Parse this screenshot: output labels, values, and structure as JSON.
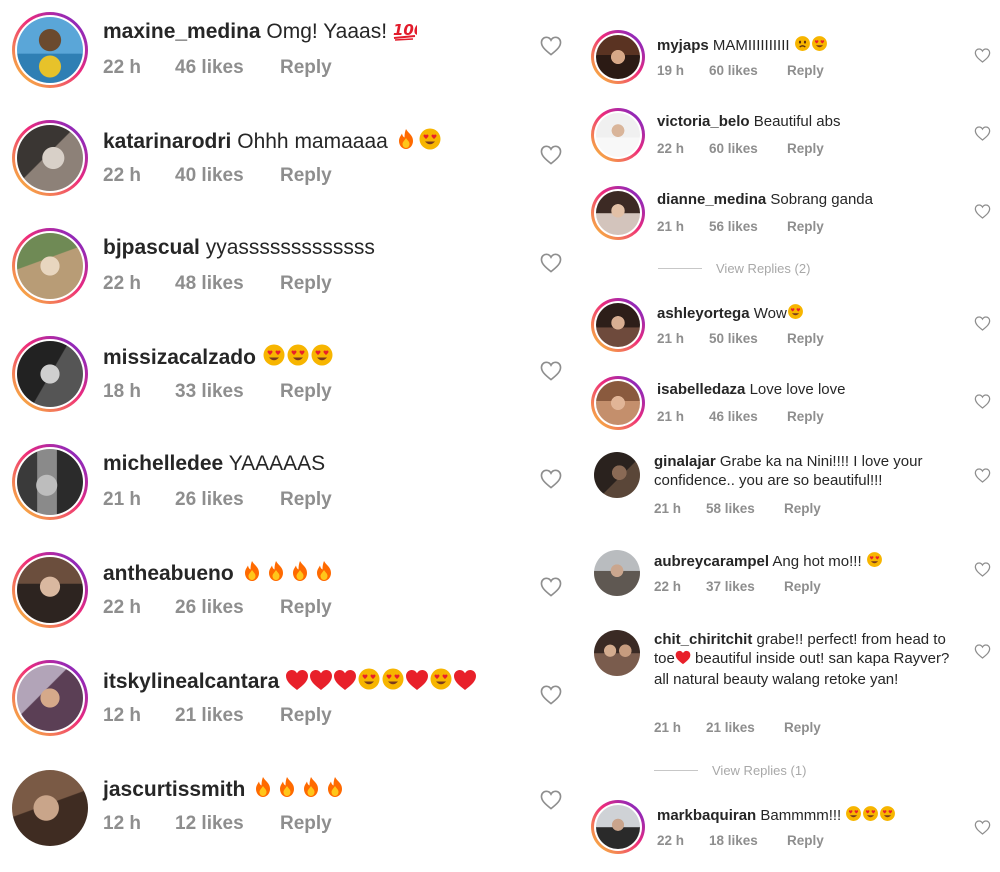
{
  "colors": {
    "story_ring": "#ee2a7b",
    "meta_text": "#8e8e8e",
    "reply_text": "#a8a8a8",
    "emoji_face": "#f7b500",
    "emoji_heart": "#e8202a",
    "emoji_fire": "#ff6a00",
    "emoji_100": "#e21c2c"
  },
  "left_comments": [
    {
      "user": "maxine_medina",
      "text": "Omg! Yaaas!",
      "emoji": [
        "100-emoji"
      ],
      "time": "22 h",
      "likes": "46 likes",
      "reply": "Reply"
    },
    {
      "user": "katarinarodri",
      "text": "Ohhh mamaaaa",
      "emoji": [
        "fire-emoji",
        "heart-eyes-emoji"
      ],
      "time": "22 h",
      "likes": "40 likes",
      "reply": "Reply"
    },
    {
      "user": "bjpascual",
      "text": "yyasssssssssssss",
      "emoji": [],
      "time": "22 h",
      "likes": "48 likes",
      "reply": "Reply"
    },
    {
      "user": "missizacalzado",
      "text": "",
      "emoji": [
        "heart-eyes-emoji",
        "heart-eyes-emoji",
        "heart-eyes-emoji"
      ],
      "time": "18 h",
      "likes": "33 likes",
      "reply": "Reply"
    },
    {
      "user": "michelledee",
      "text": "YAAAAAS",
      "emoji": [],
      "time": "21 h",
      "likes": "26 likes",
      "reply": "Reply"
    },
    {
      "user": "antheabueno",
      "text": "",
      "emoji": [
        "fire-emoji",
        "fire-emoji",
        "fire-emoji",
        "fire-emoji"
      ],
      "time": "22 h",
      "likes": "26 likes",
      "reply": "Reply"
    },
    {
      "user": "itskylinealcantara",
      "text": "",
      "emoji": [
        "red-heart-emoji",
        "red-heart-emoji",
        "red-heart-emoji",
        "heart-eyes-emoji",
        "heart-eyes-emoji",
        "red-heart-emoji",
        "heart-eyes-emoji",
        "red-heart-emoji"
      ],
      "time": "12 h",
      "likes": "21 likes",
      "reply": "Reply"
    },
    {
      "user": "jascurtissmith",
      "text": "",
      "emoji": [
        "fire-emoji",
        "fire-emoji",
        "fire-emoji",
        "fire-emoji"
      ],
      "time": "12 h",
      "likes": "12 likes",
      "reply": "Reply"
    }
  ],
  "right_comments": [
    {
      "user": "myjaps",
      "text": "MAMIIIIIIIIII",
      "emoji": [
        "sad-face-emoji",
        "heart-eyes-emoji"
      ],
      "time": "19 h",
      "likes": "60 likes",
      "reply": "Reply"
    },
    {
      "user": "victoria_belo",
      "text": "Beautiful abs",
      "emoji": [],
      "time": "22 h",
      "likes": "60 likes",
      "reply": "Reply"
    },
    {
      "user": "dianne_medina",
      "text": "Sobrang ganda",
      "emoji": [],
      "time": "21 h",
      "likes": "56 likes",
      "reply": "Reply",
      "view_replies": "View Replies (2)"
    },
    {
      "user": "ashleyortega",
      "text": "Wow",
      "emoji": [
        "heart-eyes-emoji"
      ],
      "time": "21 h",
      "likes": "50 likes",
      "reply": "Reply"
    },
    {
      "user": "isabelledaza",
      "text": "Love love love",
      "emoji": [],
      "time": "21 h",
      "likes": "46 likes",
      "reply": "Reply"
    },
    {
      "user": "ginalajar",
      "text": "Grabe ka na Nini!!!! I love your confidence.. you are so beautiful!!!",
      "emoji": [],
      "time": "21 h",
      "likes": "58 likes",
      "reply": "Reply"
    },
    {
      "user": "aubreycarampel",
      "text": "Ang hot mo!!!",
      "emoji": [
        "heart-eyes-emoji"
      ],
      "time": "22 h",
      "likes": "37 likes",
      "reply": "Reply"
    },
    {
      "user": "chit_chiritchit",
      "text": "grabe!! perfect! from head to toe",
      "text2": " beautiful inside out! san kapa Rayver? all natural beauty walang retoke yan!",
      "emoji": [
        "red-heart-emoji"
      ],
      "time": "21 h",
      "likes": "21 likes",
      "reply": "Reply",
      "view_replies": "View Replies (1)"
    },
    {
      "user": "markbaquiran",
      "text": "Bammmm!!!",
      "emoji": [
        "heart-eyes-emoji",
        "heart-eyes-emoji",
        "heart-eyes-emoji"
      ],
      "time": "22 h",
      "likes": "18 likes",
      "reply": "Reply"
    }
  ],
  "like_icon": "heart-outline-icon"
}
